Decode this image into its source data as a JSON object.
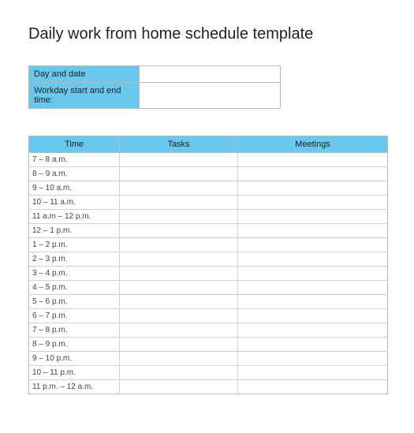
{
  "title": "Daily work from home schedule template",
  "info": {
    "rows": [
      {
        "label": "Day and date",
        "value": ""
      },
      {
        "label": "Workday start and end time:",
        "value": ""
      }
    ]
  },
  "schedule": {
    "headers": {
      "time": "Time",
      "tasks": "Tasks",
      "meetings": "Meetings"
    },
    "rows": [
      {
        "time": "7 – 8 a.m.",
        "tasks": "",
        "meetings": ""
      },
      {
        "time": "8 – 9 a.m.",
        "tasks": "",
        "meetings": ""
      },
      {
        "time": "9 – 10 a.m.",
        "tasks": "",
        "meetings": ""
      },
      {
        "time": "10 – 11 a.m.",
        "tasks": "",
        "meetings": ""
      },
      {
        "time": "11 a.m – 12 p.m.",
        "tasks": "",
        "meetings": ""
      },
      {
        "time": "12 – 1 p.m.",
        "tasks": "",
        "meetings": ""
      },
      {
        "time": "1 – 2 p.m.",
        "tasks": "",
        "meetings": ""
      },
      {
        "time": "2 – 3 p.m.",
        "tasks": "",
        "meetings": ""
      },
      {
        "time": "3 – 4 p.m.",
        "tasks": "",
        "meetings": ""
      },
      {
        "time": "4 – 5 p.m.",
        "tasks": "",
        "meetings": ""
      },
      {
        "time": "5 – 6 p.m.",
        "tasks": "",
        "meetings": ""
      },
      {
        "time": "6 – 7 p.m.",
        "tasks": "",
        "meetings": ""
      },
      {
        "time": "7 – 8 p.m.",
        "tasks": "",
        "meetings": ""
      },
      {
        "time": "8 – 9 p.m.",
        "tasks": "",
        "meetings": ""
      },
      {
        "time": "9 – 10 p.m.",
        "tasks": "",
        "meetings": ""
      },
      {
        "time": "10 – 11 p.m.",
        "tasks": "",
        "meetings": ""
      },
      {
        "time": "11 p.m. – 12 a.m.",
        "tasks": "",
        "meetings": ""
      }
    ]
  }
}
